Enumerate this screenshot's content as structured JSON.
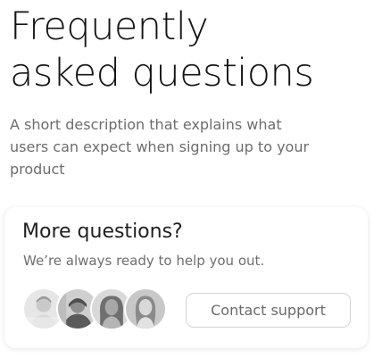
{
  "faq": {
    "heading_line1": "Frequently",
    "heading_line2": "asked questions",
    "description_line1": "A short description that explains what",
    "description_line2": "users can expect when signing up to your",
    "description_line3": "product"
  },
  "support_card": {
    "title": "More questions?",
    "subtitle": "We’re always ready to help you out.",
    "contact_button_label": "Contact support",
    "avatars": [
      {
        "icon": "person-photo-1"
      },
      {
        "icon": "person-photo-2"
      },
      {
        "icon": "person-photo-3"
      },
      {
        "icon": "person-photo-4"
      }
    ]
  },
  "colors": {
    "heading": "#141414",
    "body_text": "#6d6d6d",
    "button_border": "#d4d4d4",
    "card_background": "#ffffff"
  }
}
